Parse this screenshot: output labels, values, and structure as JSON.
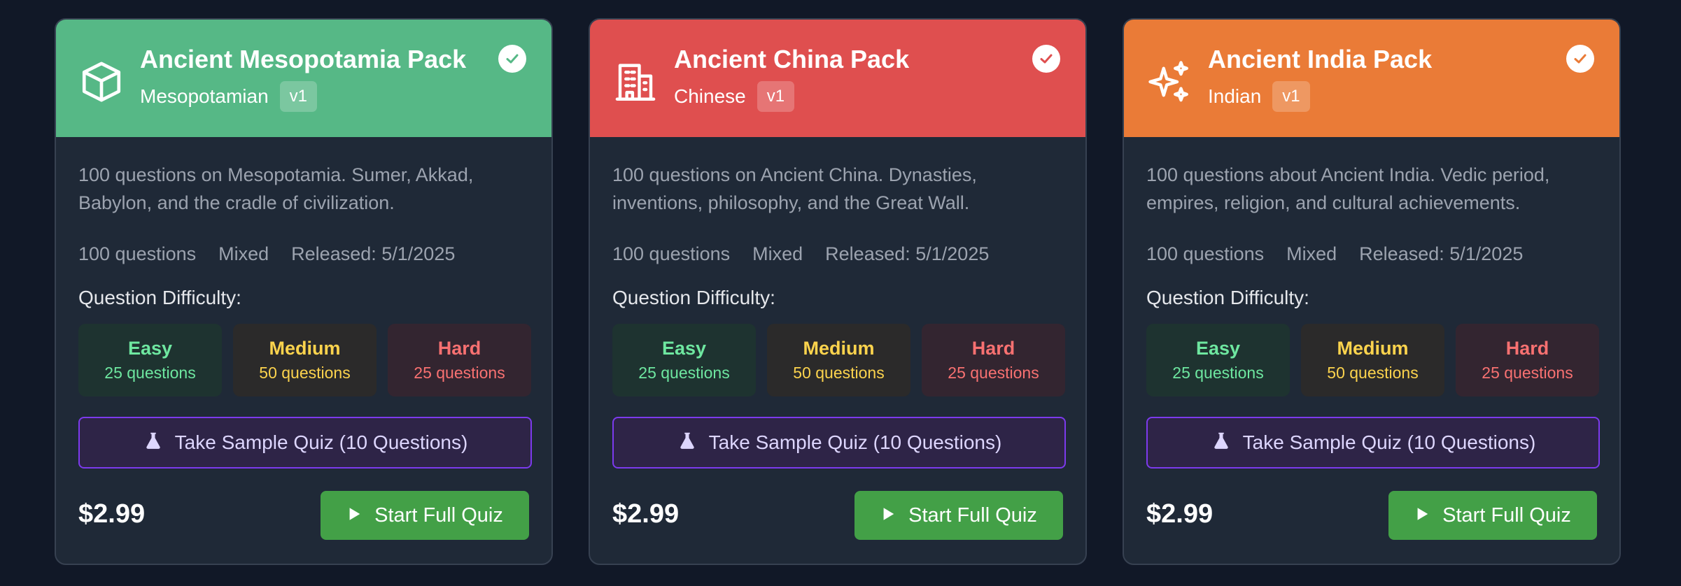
{
  "cards": [
    {
      "title": "Ancient Mesopotamia Pack",
      "region": "Mesopotamian",
      "version": "v1",
      "header_color": "#56b886",
      "icon": "cube-icon",
      "description": "100 questions on Mesopotamia. Sumer, Akkad, Babylon, and the cradle of civilization.",
      "questions": "100 questions",
      "mix": "Mixed",
      "released": "Released: 5/1/2025",
      "difficulty_label": "Question Difficulty:",
      "easy_label": "Easy",
      "easy_count": "25 questions",
      "medium_label": "Medium",
      "medium_count": "50 questions",
      "hard_label": "Hard",
      "hard_count": "25 questions",
      "sample_label": "Take Sample Quiz (10 Questions)",
      "price": "$2.99",
      "start_label": "Start Full Quiz"
    },
    {
      "title": "Ancient China Pack",
      "region": "Chinese",
      "version": "v1",
      "header_color": "#df4f4f",
      "icon": "building-icon",
      "description": "100 questions on Ancient China. Dynasties, inventions, philosophy, and the Great Wall.",
      "questions": "100 questions",
      "mix": "Mixed",
      "released": "Released: 5/1/2025",
      "difficulty_label": "Question Difficulty:",
      "easy_label": "Easy",
      "easy_count": "25 questions",
      "medium_label": "Medium",
      "medium_count": "50 questions",
      "hard_label": "Hard",
      "hard_count": "25 questions",
      "sample_label": "Take Sample Quiz (10 Questions)",
      "price": "$2.99",
      "start_label": "Start Full Quiz"
    },
    {
      "title": "Ancient India Pack",
      "region": "Indian",
      "version": "v1",
      "header_color": "#ea7b37",
      "icon": "sparkles-icon",
      "description": "100 questions about Ancient India. Vedic period, empires, religion, and cultural achievements.",
      "questions": "100 questions",
      "mix": "Mixed",
      "released": "Released: 5/1/2025",
      "difficulty_label": "Question Difficulty:",
      "easy_label": "Easy",
      "easy_count": "25 questions",
      "medium_label": "Medium",
      "medium_count": "50 questions",
      "hard_label": "Hard",
      "hard_count": "25 questions",
      "sample_label": "Take Sample Quiz (10 Questions)",
      "price": "$2.99",
      "start_label": "Start Full Quiz"
    }
  ]
}
